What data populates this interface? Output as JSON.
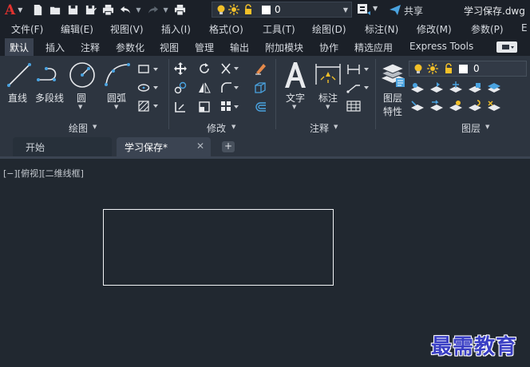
{
  "app": {
    "logo_letter": "A",
    "document_title": "学习保存.dwg"
  },
  "quick_access": {
    "layer_value": "0",
    "share_label": "共享",
    "icons": [
      "new-icon",
      "open-icon",
      "save-icon",
      "save-as-icon",
      "print-icon",
      "undo-icon",
      "redo-icon",
      "plot-icon",
      "layer-bulb-icon",
      "layer-sun-icon",
      "layer-lock-icon",
      "workspace-icon",
      "share-icon"
    ]
  },
  "menu": [
    "文件(F)",
    "编辑(E)",
    "视图(V)",
    "插入(I)",
    "格式(O)",
    "工具(T)",
    "绘图(D)",
    "标注(N)",
    "修改(M)",
    "参数(P)",
    "E"
  ],
  "ribbon_tabs": [
    "默认",
    "插入",
    "注释",
    "参数化",
    "视图",
    "管理",
    "输出",
    "附加模块",
    "协作",
    "精选应用",
    "Express Tools"
  ],
  "active_ribbon_tab": "默认",
  "ribbon": {
    "draw": {
      "panel_label": "绘图",
      "tools": [
        "直线",
        "多段线",
        "圆",
        "圆弧"
      ]
    },
    "modify": {
      "panel_label": "修改"
    },
    "annotation": {
      "panel_label": "注释",
      "tools": [
        "文字",
        "标注"
      ]
    },
    "layers": {
      "panel_label": "图层",
      "layer_properties": [
        "图层",
        "特性"
      ],
      "layer_value": "0"
    }
  },
  "doc_tabs": {
    "home": "开始",
    "active": "学习保存*",
    "close": "✕",
    "add": "+"
  },
  "viewport": {
    "label": "[−][俯视][二维线框]"
  },
  "watermark": "最需教育",
  "colors": {
    "accent_red": "#e0322f",
    "ribbon_bg": "#2d3540",
    "canvas_bg": "#212830",
    "icon_blue": "#4aa3e0",
    "bulb_yellow": "#f2c029"
  }
}
